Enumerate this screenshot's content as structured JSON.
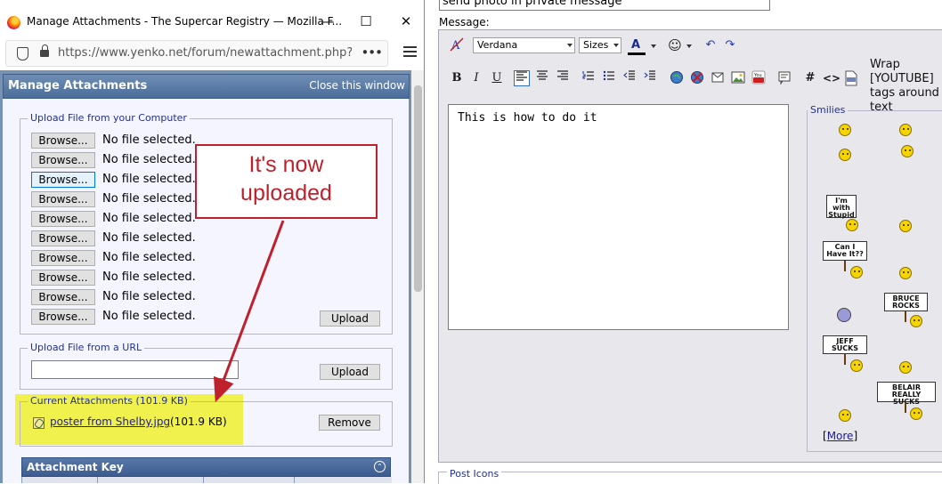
{
  "window": {
    "title": "Manage Attachments - The Supercar Registry — Mozilla F...",
    "url": "https://www.yenko.net/forum/newattachment.php?do=",
    "url_more": "•••",
    "minimize": "—",
    "maximize": "☐",
    "close": "✕"
  },
  "manage": {
    "title": "Manage Attachments",
    "close_link": "Close this window",
    "upload_computer_legend": "Upload File from your Computer",
    "browse_label": "Browse...",
    "rows": [
      {
        "status": "No file selected."
      },
      {
        "status": "No file selected."
      },
      {
        "status": "No file selected."
      },
      {
        "status": "No file selected."
      },
      {
        "status": "No file selected."
      },
      {
        "status": "No file selected."
      },
      {
        "status": "No file selected."
      },
      {
        "status": "No file selected."
      },
      {
        "status": "No file selected."
      },
      {
        "status": "No file selected."
      }
    ],
    "upload_label": "Upload",
    "upload_url_legend": "Upload File from a URL",
    "url_value": "",
    "current_legend": "Current Attachments (101.9 KB)",
    "attachment": {
      "name": "poster from Shelby.jpg",
      "size": "(101.9 KB)"
    },
    "remove_label": "Remove",
    "key_title": "Attachment Key",
    "key_collapse": "⌃"
  },
  "annotation": {
    "line1": "It's now",
    "line2": "uploaded",
    "color": "#c0202b",
    "highlight_color": "#f1f14d"
  },
  "editor": {
    "subject_value": "send photo in private message",
    "message_label": "Message:",
    "font": "Verdana",
    "size": "Sizes",
    "text_color_glyph": "A",
    "body": "This is how to do it",
    "wrap_text": "Wrap [YOUTUBE] tags around text",
    "toolbar": {
      "bold": "B",
      "italic": "I",
      "underline": "U",
      "hash": "#",
      "code": "<>",
      "undo": "↶",
      "redo": "↷"
    },
    "smilies_legend": "Smilies",
    "signs": {
      "im_with_stupid": "I'm with Stupid",
      "can_i": "Can I Have It??",
      "bruce": "BRUCE ROCKS",
      "jeff": "JEFF SUCKS",
      "belair": "BELAIR REALLY SUCKS"
    },
    "more_open": "[",
    "more_label": "More",
    "more_close": "]",
    "post_icons": "Post Icons"
  }
}
